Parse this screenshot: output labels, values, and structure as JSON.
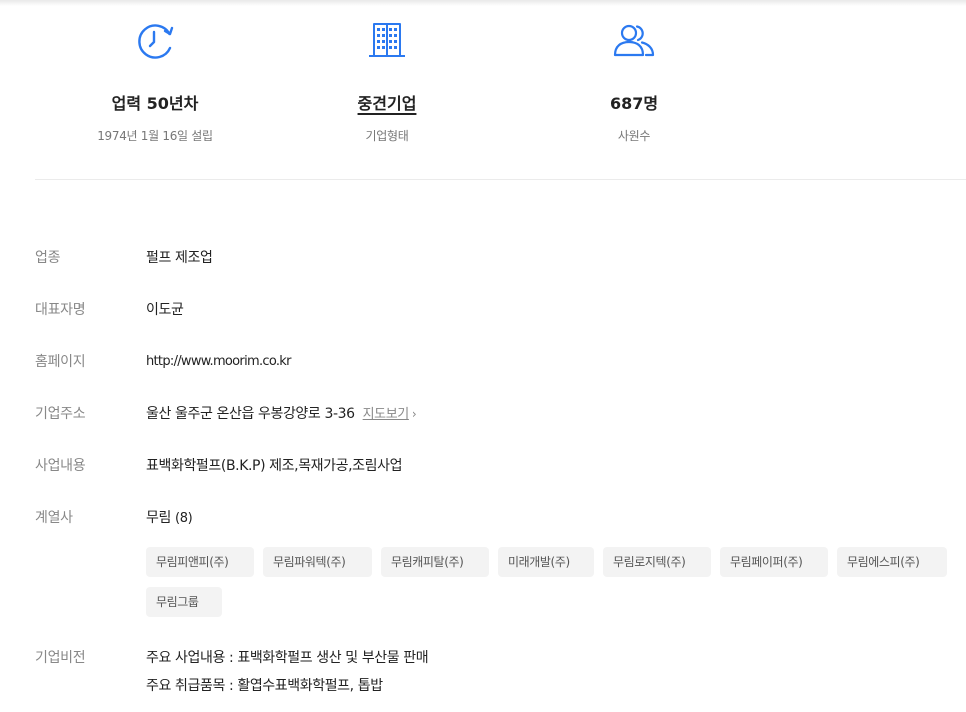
{
  "stats": [
    {
      "icon": "clock-icon",
      "value": "업력 50년차",
      "sub": "1974년 1월 16일 설립"
    },
    {
      "icon": "building-icon",
      "value": "중견기업",
      "sub": "기업형태"
    },
    {
      "icon": "people-icon",
      "value": "687명",
      "sub": "사원수"
    }
  ],
  "info": {
    "industry": {
      "label": "업종",
      "value": "펄프 제조업"
    },
    "ceo": {
      "label": "대표자명",
      "value": "이도균"
    },
    "homepage": {
      "label": "홈페이지",
      "value": "http://www.moorim.co.kr"
    },
    "address": {
      "label": "기업주소",
      "value": "울산 울주군 온산읍 우봉강양로 3-36",
      "map_link": "지도보기",
      "map_chevron": "›"
    },
    "business": {
      "label": "사업내용",
      "value": "표백화학펄프(B.K.P) 제조,목재가공,조림사업"
    },
    "affiliates": {
      "label": "계열사",
      "group": "무림",
      "count": "(8)",
      "items": [
        "무림피앤피(주)",
        "무림파워텍(주)",
        "무림캐피탈(주)",
        "미래개발(주)",
        "무림로지텍(주)",
        "무림페이퍼(주)",
        "무림에스피(주)",
        "무림그룹"
      ]
    },
    "vision": {
      "label": "기업비전",
      "lines": [
        "주요 사업내용 : 표백화학펄프 생산 및 부산물 판매",
        "주요 취급품목 : 활엽수표백화학펄프, 톱밥"
      ]
    }
  },
  "colors": {
    "accent": "#2b79f0",
    "label": "#888888",
    "chip_bg": "#f3f3f3"
  }
}
